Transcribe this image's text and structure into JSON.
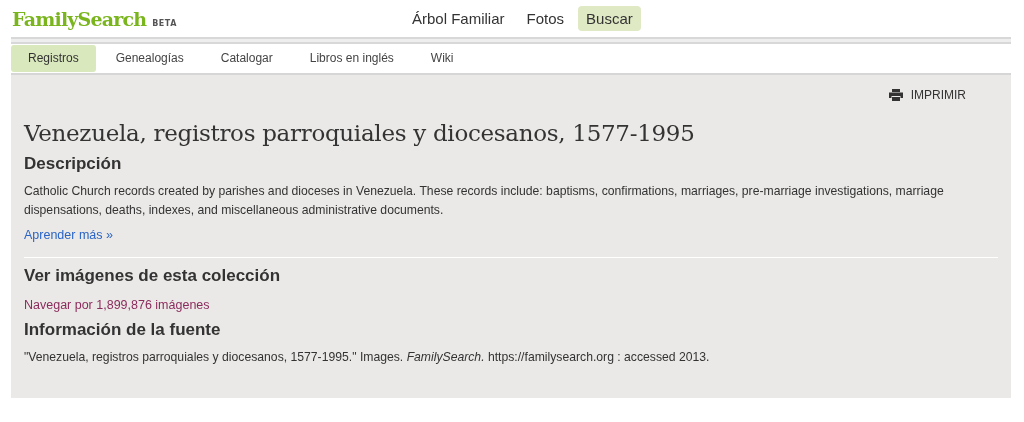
{
  "header": {
    "logo": "FamilySearch",
    "logo_badge": "BETA",
    "nav": [
      {
        "label": "Árbol Familiar",
        "selected": false
      },
      {
        "label": "Fotos",
        "selected": false
      },
      {
        "label": "Buscar",
        "selected": true
      }
    ]
  },
  "tabs": [
    {
      "label": "Registros",
      "selected": true
    },
    {
      "label": "Genealogías",
      "selected": false
    },
    {
      "label": "Catalogar",
      "selected": false
    },
    {
      "label": "Libros en inglés",
      "selected": false
    },
    {
      "label": "Wiki",
      "selected": false
    }
  ],
  "print_button": "IMPRIMIR",
  "title": "Venezuela, registros parroquiales y diocesanos, 1577-1995",
  "description": {
    "heading": "Descripción",
    "text": "Catholic Church records created by parishes and dioceses in Venezuela. These records include: baptisms, confirmations, marriages, pre-marriage investigations, marriage dispensations, deaths, indexes, and miscellaneous administrative documents.",
    "link": "Aprender más »"
  },
  "images": {
    "heading": "Ver imágenes de esta colección",
    "link": "Navegar por 1,899,876 imágenes"
  },
  "source": {
    "heading": "Información de la fuente",
    "text": "\"Venezuela, registros parroquiales y diocesanos, 1577-1995.\" Images. *FamilySearch.* https://familysearch.org : accessed 2013."
  }
}
